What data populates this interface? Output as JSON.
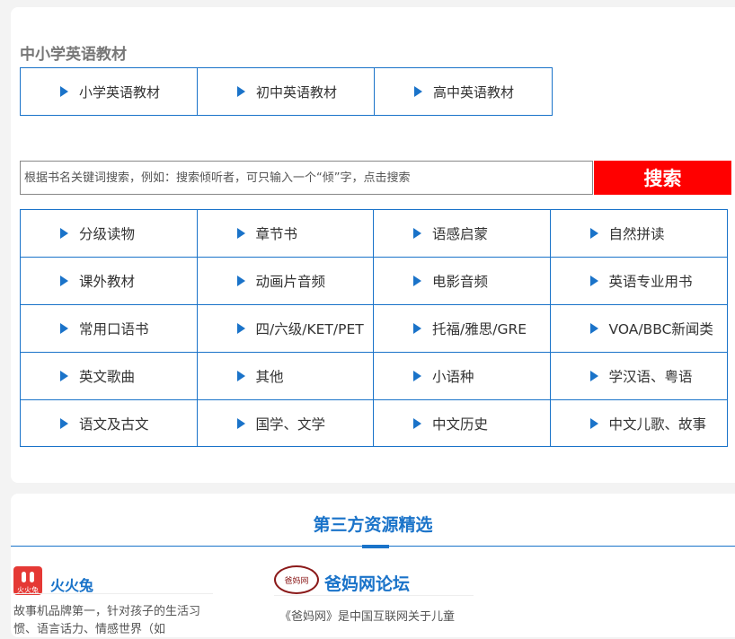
{
  "textbook_section": {
    "title": "中小学英语教材",
    "items": [
      "小学英语教材",
      "初中英语教材",
      "高中英语教材"
    ]
  },
  "search": {
    "placeholder": "根据书名关键词搜索，例如：搜索倾听者，可只输入一个“倾”字，点击搜索",
    "button_label": "搜索"
  },
  "categories": [
    [
      "分级读物",
      "章节书",
      "语感启蒙",
      "自然拼读"
    ],
    [
      "课外教材",
      "动画片音频",
      "电影音频",
      "英语专业用书"
    ],
    [
      "常用口语书",
      "四/六级/KET/PET",
      "托福/雅思/GRE",
      "VOA/BBC新闻类"
    ],
    [
      "英文歌曲",
      "其他",
      "小语种",
      "学汉语、粤语"
    ],
    [
      "语文及古文",
      "国学、文学",
      "中文历史",
      "中文儿歌、故事"
    ]
  ],
  "third_party": {
    "title": "第三方资源精选",
    "resources": [
      {
        "name": "火火兔",
        "logo_text": "火火兔",
        "description": "故事机品牌第一，针对孩子的生活习惯、语言话力、情感世界（如"
      },
      {
        "name": "爸妈网论坛",
        "logo_text": "爸妈网",
        "description": "《爸妈网》是中国互联网关于儿童"
      }
    ]
  },
  "colors": {
    "accent": "#1a73c9",
    "search_button": "#ff0000"
  }
}
